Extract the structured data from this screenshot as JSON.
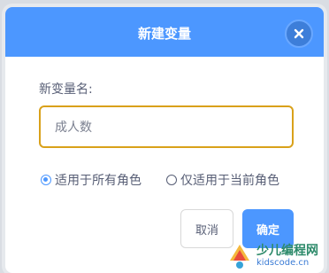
{
  "dialog": {
    "title": "新建变量",
    "close_icon": "close-icon",
    "name_label": "新变量名:",
    "name_input_value": "成人数",
    "scope_options": [
      {
        "label": "适用于所有角色",
        "checked": true
      },
      {
        "label": "仅适用于当前角色",
        "checked": false
      }
    ],
    "cancel_label": "取消",
    "ok_label": "确定"
  },
  "watermark": {
    "brand": "少儿编程网",
    "domain": "kidscode.cn"
  },
  "colors": {
    "header": "#4c97ff",
    "input_border": "#d9a11a",
    "primary_button": "#4c97ff"
  }
}
